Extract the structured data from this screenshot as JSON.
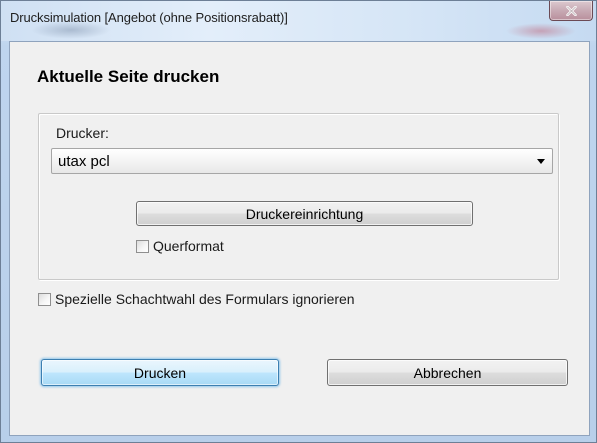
{
  "window": {
    "title": "Drucksimulation [Angebot (ohne Positionsrabatt)]",
    "close_label": "X"
  },
  "dialog": {
    "heading": "Aktuelle Seite drucken",
    "printer_group": {
      "printer_label": "Drucker:",
      "printer_selected": "utax pcl",
      "setup_button_label": "Druckereinrichtung",
      "landscape_label": "Querformat",
      "landscape_checked": false
    },
    "ignore_tray_label": "Spezielle Schachtwahl des Formulars ignorieren",
    "ignore_tray_checked": false,
    "print_button_label": "Drucken",
    "cancel_button_label": "Abbrechen"
  },
  "icons": {
    "close": "close-icon",
    "dropdown": "chevron-down-icon"
  },
  "colors": {
    "default_button_border": "#3c7fb1",
    "close_button": "#c8aab4",
    "dialog_background": "#f0f0f0"
  }
}
